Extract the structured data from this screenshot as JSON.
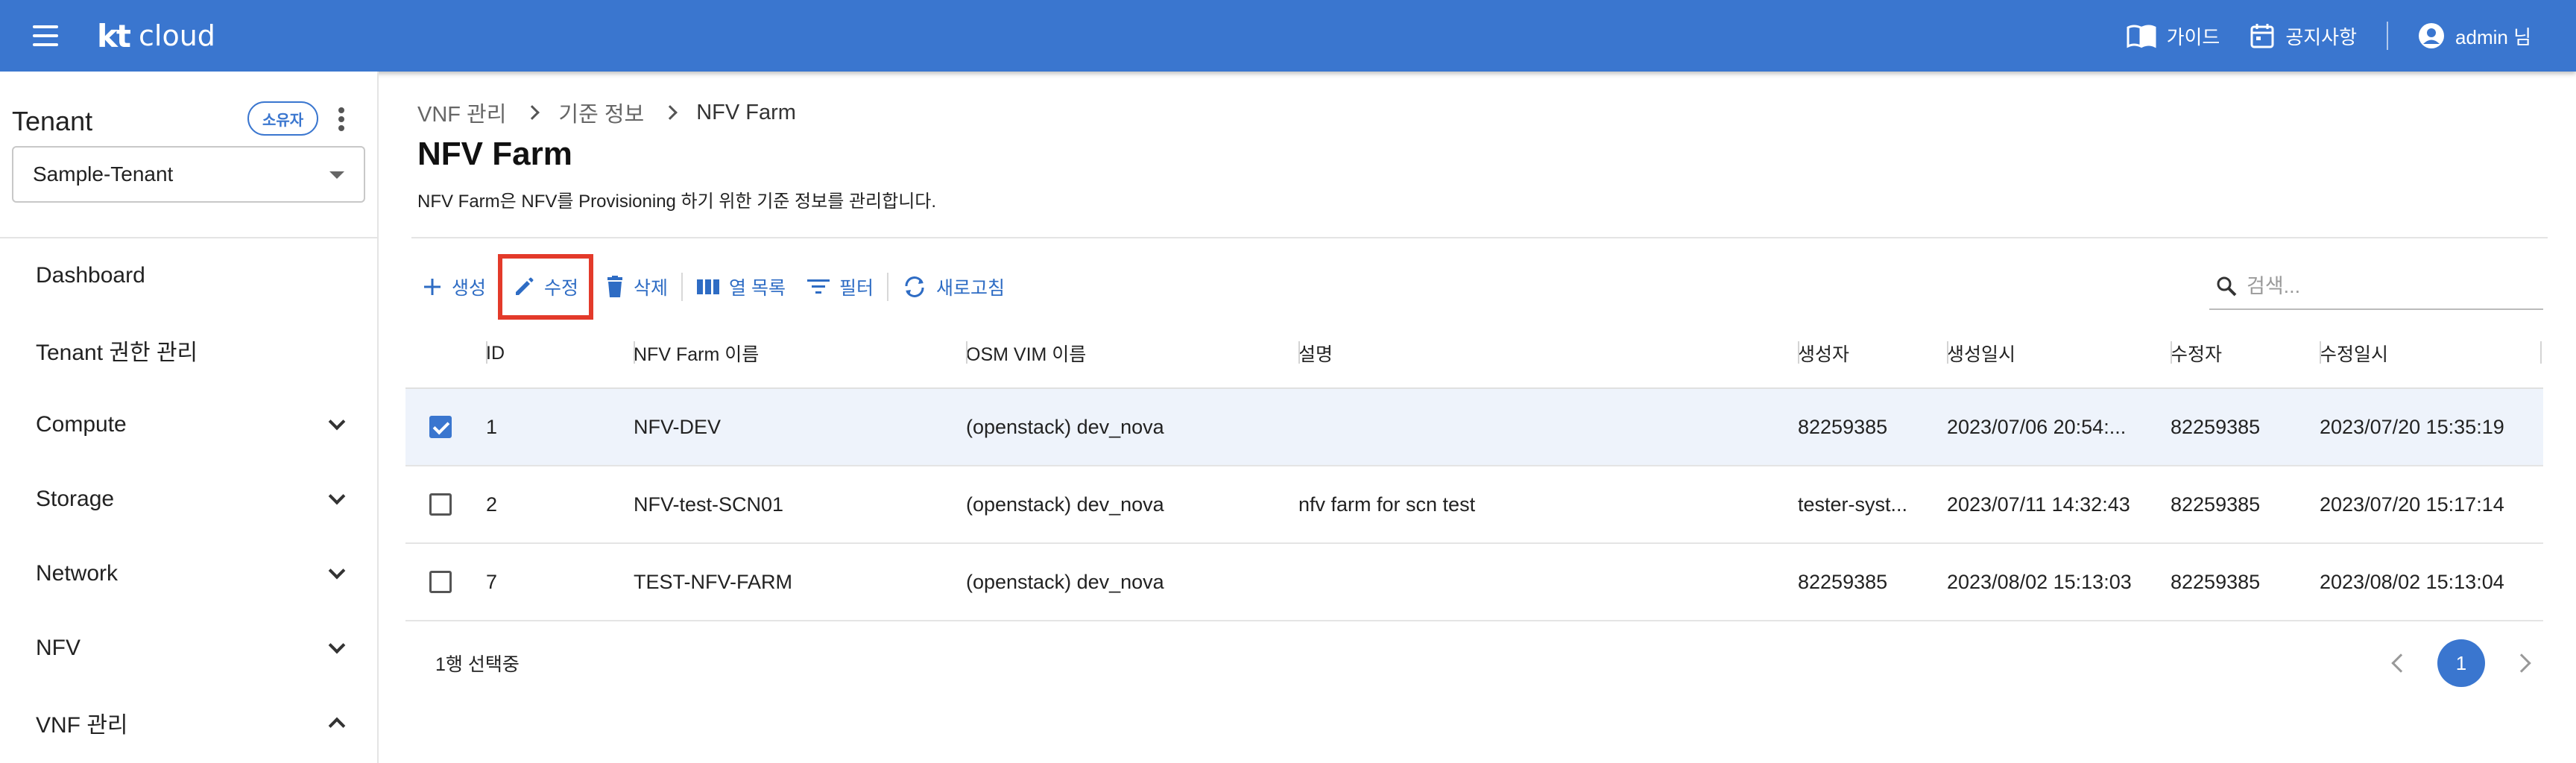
{
  "header": {
    "logo_kt": "kt",
    "logo_cloud": "cloud",
    "guide_label": "가이드",
    "notice_label": "공지사항",
    "user_label": "admin 님",
    "brand_color": "#3a76cf"
  },
  "sidebar": {
    "tenant_title": "Tenant",
    "owner_badge": "소유자",
    "tenant_selected": "Sample-Tenant",
    "items": [
      {
        "label": "Dashboard",
        "expandable": false
      },
      {
        "label": "Tenant 권한 관리",
        "expandable": false
      },
      {
        "label": "Compute",
        "expandable": true,
        "expanded": false
      },
      {
        "label": "Storage",
        "expandable": true,
        "expanded": false
      },
      {
        "label": "Network",
        "expandable": true,
        "expanded": false
      },
      {
        "label": "NFV",
        "expandable": true,
        "expanded": false
      },
      {
        "label": "VNF 관리",
        "expandable": true,
        "expanded": true
      }
    ]
  },
  "breadcrumb": [
    "VNF 관리",
    "기준 정보",
    "NFV Farm"
  ],
  "page": {
    "title": "NFV Farm",
    "description": "NFV Farm은 NFV를 Provisioning 하기 위한 기준 정보를 관리합니다."
  },
  "toolbar": {
    "create_label": "생성",
    "edit_label": "수정",
    "delete_label": "삭제",
    "columns_label": "열 목록",
    "filter_label": "필터",
    "refresh_label": "새로고침",
    "highlight_color": "#e33a2a"
  },
  "search": {
    "placeholder": "검색..."
  },
  "table": {
    "columns": [
      "ID",
      "NFV Farm 이름",
      "OSM VIM 이름",
      "설명",
      "생성자",
      "생성일시",
      "수정자",
      "수정일시"
    ],
    "rows": [
      {
        "selected": true,
        "id": "1",
        "name": "NFV-DEV",
        "vim": "(openstack) dev_nova",
        "desc": "",
        "creator": "82259385",
        "created": "2023/07/06 20:54:...",
        "modifier": "82259385",
        "modified": "2023/07/20 15:35:19"
      },
      {
        "selected": false,
        "id": "2",
        "name": "NFV-test-SCN01",
        "vim": "(openstack) dev_nova",
        "desc": "nfv farm for scn test",
        "creator": "tester-syst...",
        "created": "2023/07/11 14:32:43",
        "modifier": "82259385",
        "modified": "2023/07/20 15:17:14"
      },
      {
        "selected": false,
        "id": "7",
        "name": "TEST-NFV-FARM",
        "vim": "(openstack) dev_nova",
        "desc": "",
        "creator": "82259385",
        "created": "2023/08/02 15:13:03",
        "modifier": "82259385",
        "modified": "2023/08/02 15:13:04"
      }
    ]
  },
  "footer": {
    "selection_text": "1행 선택중",
    "current_page": "1"
  }
}
